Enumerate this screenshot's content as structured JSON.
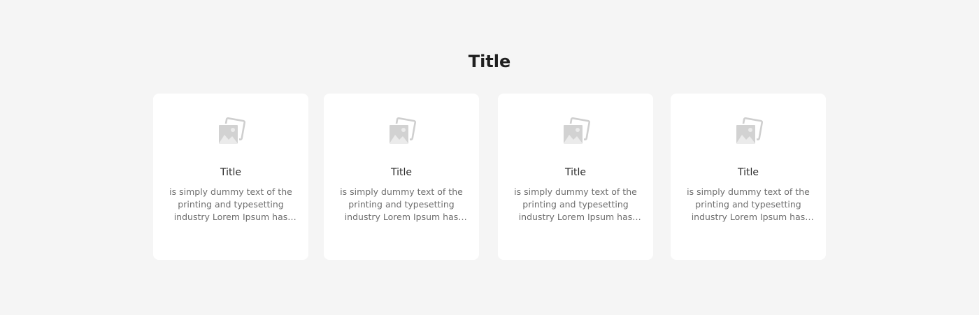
{
  "section": {
    "title": "Title"
  },
  "colors": {
    "background": "#f5f5f5",
    "card": "#ffffff",
    "icon": "#cfcfcf"
  },
  "cards": [
    {
      "icon": "image-placeholder-icon",
      "title": "Title",
      "description": "is simply dummy text of the printing and typesetting industry Lorem Ipsum has been the industry's standard"
    },
    {
      "icon": "image-placeholder-icon",
      "title": "Title",
      "description": "is simply dummy text of the printing and typesetting industry Lorem Ipsum has been the industry's standard"
    },
    {
      "icon": "image-placeholder-icon",
      "title": "Title",
      "description": "is simply dummy text of the printing and typesetting industry Lorem Ipsum has been the industry's standard"
    },
    {
      "icon": "image-placeholder-icon",
      "title": "Title",
      "description": "is simply dummy text of the printing and typesetting industry Lorem Ipsum has been the industry's standard"
    }
  ]
}
